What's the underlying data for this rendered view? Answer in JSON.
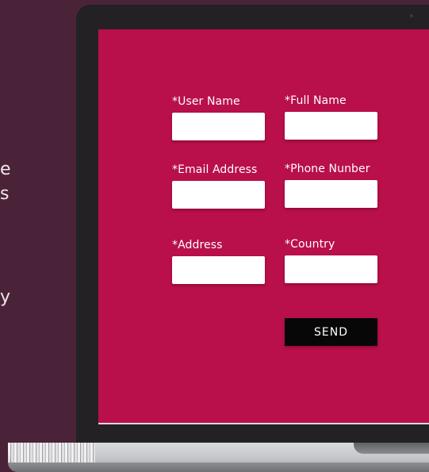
{
  "side_text": {
    "line1": "e",
    "line2": "s",
    "line3": "y"
  },
  "form": {
    "fields": [
      {
        "label": "*User Name",
        "value": "",
        "placeholder": ""
      },
      {
        "label": "*Full Name",
        "value": "",
        "placeholder": ""
      },
      {
        "label": "*Email Address",
        "value": "",
        "placeholder": ""
      },
      {
        "label": "*Phone Nunber",
        "value": "",
        "placeholder": ""
      },
      {
        "label": "*Address",
        "value": "",
        "placeholder": ""
      },
      {
        "label": "*Country",
        "value": "",
        "placeholder": ""
      }
    ],
    "send_label": "SEND"
  },
  "colors": {
    "page_background": "#4b2339",
    "screen_background": "#b90f4a",
    "button_background": "#070707",
    "field_background": "#ffffff"
  }
}
